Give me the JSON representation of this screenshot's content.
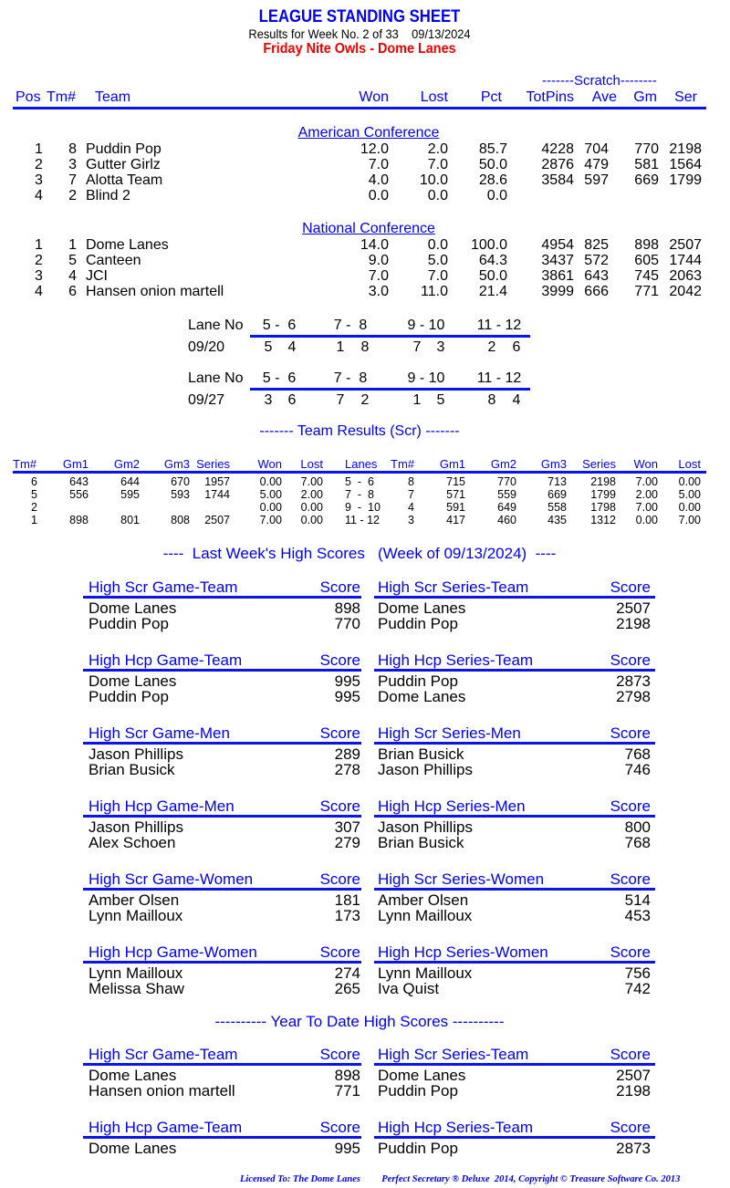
{
  "header": {
    "title": "LEAGUE STANDING SHEET",
    "subtitle": "Results for Week No. 2 of 33    09/13/2024",
    "league": "Friday Nite Owls - Dome Lanes"
  },
  "colors": {
    "heading_blue": "#0000ee",
    "league_red": "#ee0000",
    "rule_blue": "#0a14e6"
  },
  "standings": {
    "scratch_label": "-------Scratch--------",
    "columns": [
      "Pos",
      "Tm#",
      "Team",
      "Won",
      "Lost",
      "Pct",
      "TotPins",
      "Ave",
      "Gm",
      "Ser"
    ],
    "conferences": [
      {
        "name": "American Conference",
        "rows": [
          {
            "pos": "1",
            "tm": "8",
            "team": "Puddin Pop",
            "won": "12.0",
            "lost": "2.0",
            "pct": "85.7",
            "totpins": "4228",
            "ave": "704",
            "gm": "770",
            "ser": "2198"
          },
          {
            "pos": "2",
            "tm": "3",
            "team": "Gutter Girlz",
            "won": "7.0",
            "lost": "7.0",
            "pct": "50.0",
            "totpins": "2876",
            "ave": "479",
            "gm": "581",
            "ser": "1564"
          },
          {
            "pos": "3",
            "tm": "7",
            "team": "Alotta Team",
            "won": "4.0",
            "lost": "10.0",
            "pct": "28.6",
            "totpins": "3584",
            "ave": "597",
            "gm": "669",
            "ser": "1799"
          },
          {
            "pos": "4",
            "tm": "2",
            "team": "Blind 2",
            "won": "0.0",
            "lost": "0.0",
            "pct": "0.0",
            "totpins": "",
            "ave": "",
            "gm": "",
            "ser": ""
          }
        ]
      },
      {
        "name": "National Conference",
        "rows": [
          {
            "pos": "1",
            "tm": "1",
            "team": "Dome Lanes",
            "won": "14.0",
            "lost": "0.0",
            "pct": "100.0",
            "totpins": "4954",
            "ave": "825",
            "gm": "898",
            "ser": "2507"
          },
          {
            "pos": "2",
            "tm": "5",
            "team": "Canteen",
            "won": "9.0",
            "lost": "5.0",
            "pct": "64.3",
            "totpins": "3437",
            "ave": "572",
            "gm": "605",
            "ser": "1744"
          },
          {
            "pos": "3",
            "tm": "4",
            "team": "JCI",
            "won": "7.0",
            "lost": "7.0",
            "pct": "50.0",
            "totpins": "3861",
            "ave": "643",
            "gm": "745",
            "ser": "2063"
          },
          {
            "pos": "4",
            "tm": "6",
            "team": "Hansen onion martell",
            "won": "3.0",
            "lost": "11.0",
            "pct": "21.4",
            "totpins": "3999",
            "ave": "666",
            "gm": "771",
            "ser": "2042"
          }
        ]
      }
    ]
  },
  "lane_schedule": {
    "label": "Lane No",
    "lanes": [
      "5 -  6",
      "7 -  8",
      "9 - 10",
      "11 - 12"
    ],
    "weeks": [
      {
        "date": "09/20",
        "pairs": [
          [
            "5",
            "4"
          ],
          [
            "1",
            "8"
          ],
          [
            "7",
            "3"
          ],
          [
            "2",
            "6"
          ]
        ]
      },
      {
        "date": "09/27",
        "pairs": [
          [
            "3",
            "6"
          ],
          [
            "7",
            "2"
          ],
          [
            "1",
            "5"
          ],
          [
            "8",
            "4"
          ]
        ]
      }
    ]
  },
  "team_results": {
    "title": "------- Team Results (Scr) -------",
    "left_columns": [
      "Tm#",
      "Gm1",
      "Gm2",
      "Gm3",
      "Series",
      "Won",
      "Lost"
    ],
    "mid_column": "Lanes",
    "right_columns": [
      "Tm#",
      "Gm1",
      "Gm2",
      "Gm3",
      "Series",
      "Won",
      "Lost"
    ],
    "rows": [
      {
        "left": {
          "tm": "6",
          "gm1": "643",
          "gm2": "644",
          "gm3": "670",
          "series": "1957",
          "won": "0.00",
          "lost": "7.00"
        },
        "lanes": "5  -  6",
        "right": {
          "tm": "8",
          "gm1": "715",
          "gm2": "770",
          "gm3": "713",
          "series": "2198",
          "won": "7.00",
          "lost": "0.00"
        }
      },
      {
        "left": {
          "tm": "5",
          "gm1": "556",
          "gm2": "595",
          "gm3": "593",
          "series": "1744",
          "won": "5.00",
          "lost": "2.00"
        },
        "lanes": "7  -  8",
        "right": {
          "tm": "7",
          "gm1": "571",
          "gm2": "559",
          "gm3": "669",
          "series": "1799",
          "won": "2.00",
          "lost": "5.00"
        }
      },
      {
        "left": {
          "tm": "2",
          "gm1": "",
          "gm2": "",
          "gm3": "",
          "series": "",
          "won": "0.00",
          "lost": "0.00"
        },
        "lanes": "9  -  10",
        "right": {
          "tm": "4",
          "gm1": "591",
          "gm2": "649",
          "gm3": "558",
          "series": "1798",
          "won": "7.00",
          "lost": "0.00"
        }
      },
      {
        "left": {
          "tm": "1",
          "gm1": "898",
          "gm2": "801",
          "gm3": "808",
          "series": "2507",
          "won": "7.00",
          "lost": "0.00"
        },
        "lanes": "11 - 12",
        "right": {
          "tm": "3",
          "gm1": "417",
          "gm2": "460",
          "gm3": "435",
          "series": "1312",
          "won": "0.00",
          "lost": "7.00"
        }
      }
    ]
  },
  "last_week": {
    "title": "----  Last Week's High Scores   (Week of 09/13/2024)  ----",
    "score_label": "Score",
    "blocks": [
      {
        "left": {
          "title": "High Scr Game-Team",
          "entries": [
            [
              "Dome Lanes",
              "898"
            ],
            [
              "Puddin Pop",
              "770"
            ]
          ]
        },
        "right": {
          "title": "High Scr Series-Team",
          "entries": [
            [
              "Dome Lanes",
              "2507"
            ],
            [
              "Puddin Pop",
              "2198"
            ]
          ]
        }
      },
      {
        "left": {
          "title": "High Hcp Game-Team",
          "entries": [
            [
              "Dome Lanes",
              "995"
            ],
            [
              "Puddin Pop",
              "995"
            ]
          ]
        },
        "right": {
          "title": "High Hcp Series-Team",
          "entries": [
            [
              "Puddin Pop",
              "2873"
            ],
            [
              "Dome Lanes",
              "2798"
            ]
          ]
        }
      },
      {
        "left": {
          "title": "High Scr Game-Men",
          "entries": [
            [
              "Jason Phillips",
              "289"
            ],
            [
              "Brian Busick",
              "278"
            ]
          ]
        },
        "right": {
          "title": "High Scr Series-Men",
          "entries": [
            [
              "Brian Busick",
              "768"
            ],
            [
              "Jason Phillips",
              "746"
            ]
          ]
        }
      },
      {
        "left": {
          "title": "High Hcp Game-Men",
          "entries": [
            [
              "Jason Phillips",
              "307"
            ],
            [
              "Alex Schoen",
              "279"
            ]
          ]
        },
        "right": {
          "title": "High Hcp Series-Men",
          "entries": [
            [
              "Jason Phillips",
              "800"
            ],
            [
              "Brian Busick",
              "768"
            ]
          ]
        }
      },
      {
        "left": {
          "title": "High Scr Game-Women",
          "entries": [
            [
              "Amber Olsen",
              "181"
            ],
            [
              "Lynn Mailloux",
              "173"
            ]
          ]
        },
        "right": {
          "title": "High Scr Series-Women",
          "entries": [
            [
              "Amber Olsen",
              "514"
            ],
            [
              "Lynn Mailloux",
              "453"
            ]
          ]
        }
      },
      {
        "left": {
          "title": "High Hcp Game-Women",
          "entries": [
            [
              "Lynn Mailloux",
              "274"
            ],
            [
              "Melissa Shaw",
              "265"
            ]
          ]
        },
        "right": {
          "title": "High Hcp Series-Women",
          "entries": [
            [
              "Lynn Mailloux",
              "756"
            ],
            [
              "Iva Quist",
              "742"
            ]
          ]
        }
      }
    ]
  },
  "ytd": {
    "title": "---------- Year To Date High Scores ----------",
    "score_label": "Score",
    "blocks": [
      {
        "left": {
          "title": "High Scr Game-Team",
          "entries": [
            [
              "Dome Lanes",
              "898"
            ],
            [
              "Hansen onion martell",
              "771"
            ]
          ]
        },
        "right": {
          "title": "High Scr Series-Team",
          "entries": [
            [
              "Dome Lanes",
              "2507"
            ],
            [
              "Puddin Pop",
              "2198"
            ]
          ]
        }
      },
      {
        "left": {
          "title": "High Hcp Game-Team",
          "entries": [
            [
              "Dome Lanes",
              "995"
            ]
          ]
        },
        "right": {
          "title": "High Hcp Series-Team",
          "entries": [
            [
              "Puddin Pop",
              "2873"
            ]
          ]
        }
      }
    ]
  },
  "footer": {
    "licensed": "Licensed To: The Dome Lanes",
    "copyright": "Perfect Secretary ® Deluxe  2014, Copyright © Treasure Software Co. 2013"
  }
}
